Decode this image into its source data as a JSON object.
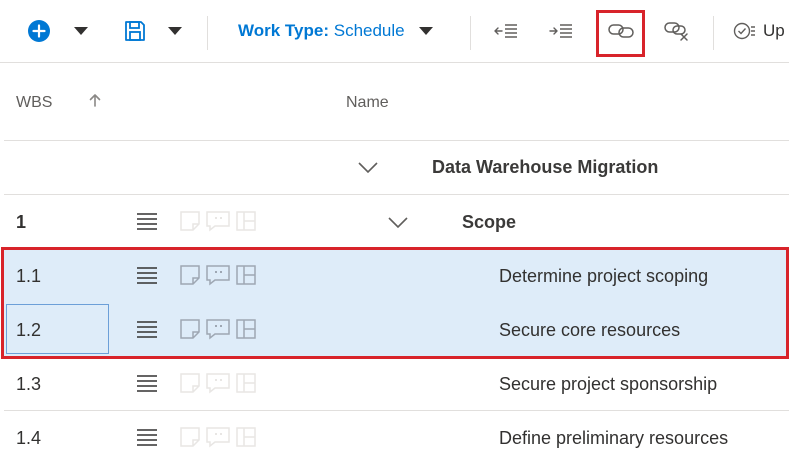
{
  "toolbar": {
    "work_type_label": "Work Type:",
    "work_type_value": "Schedule",
    "update_label": "Up"
  },
  "grid": {
    "columns": {
      "wbs": "WBS",
      "name": "Name"
    },
    "rows": [
      {
        "wbs": "",
        "name": "Data Warehouse Migration"
      },
      {
        "wbs": "1",
        "name": "Scope"
      },
      {
        "wbs": "1.1",
        "name": "Determine project scoping"
      },
      {
        "wbs": "1.2",
        "name": "Secure core resources"
      },
      {
        "wbs": "1.3",
        "name": "Secure project sponsorship"
      },
      {
        "wbs": "1.4",
        "name": "Define preliminary resources"
      }
    ]
  },
  "colors": {
    "accent": "#0078d4",
    "highlight": "#d8232a",
    "selection": "#deecf9"
  }
}
